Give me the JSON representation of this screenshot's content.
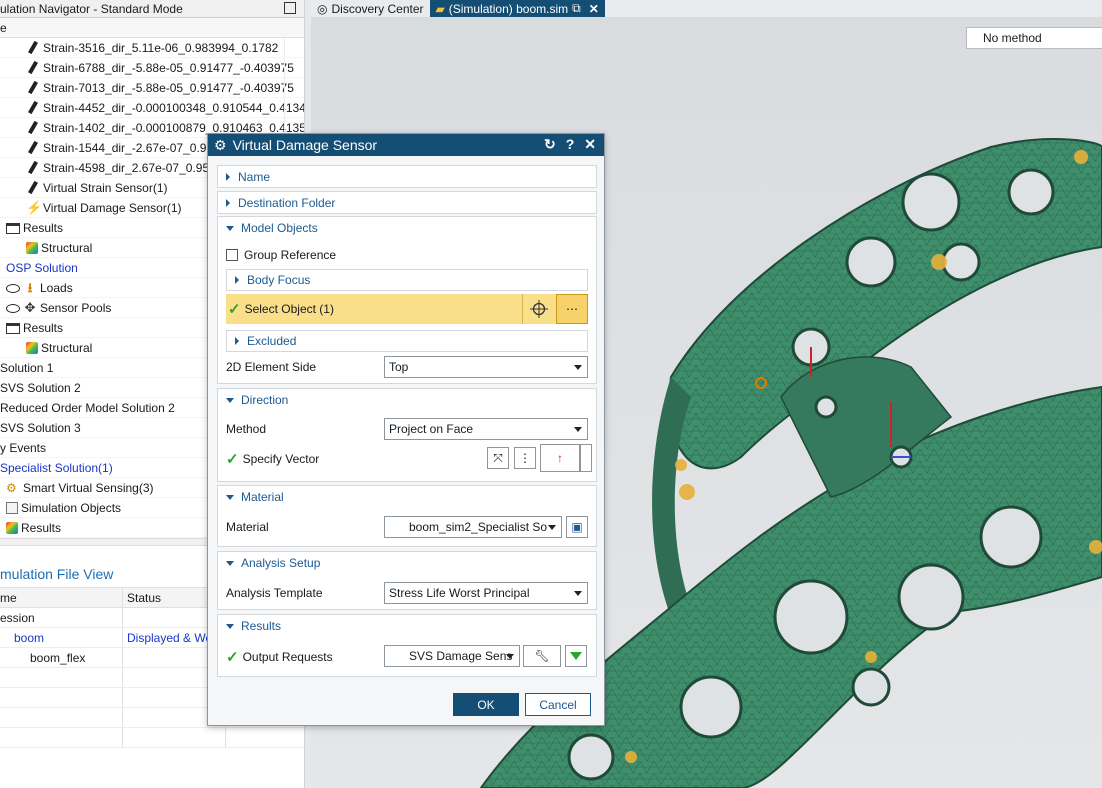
{
  "navigator": {
    "title": "ulation Navigator - Standard Mode",
    "column": "e",
    "rows": [
      {
        "indent": 26,
        "icon": "strain-icon",
        "label": "Strain-3516_dir_5.11e-06_0.983994_0.1782"
      },
      {
        "indent": 26,
        "icon": "strain-icon",
        "label": "Strain-6788_dir_-5.88e-05_0.91477_-0.403975"
      },
      {
        "indent": 26,
        "icon": "strain-icon",
        "label": "Strain-7013_dir_-5.88e-05_0.91477_-0.403975"
      },
      {
        "indent": 26,
        "icon": "strain-icon",
        "label": "Strain-4452_dir_-0.000100348_0.910544_0.4134"
      },
      {
        "indent": 26,
        "icon": "strain-icon",
        "label": "Strain-1402_dir_-0.000100879_0.910463_0.4135"
      },
      {
        "indent": 26,
        "icon": "strain-icon",
        "label": "Strain-1544_dir_-2.67e-07_0.953"
      },
      {
        "indent": 26,
        "icon": "strain-icon",
        "label": "Strain-4598_dir_2.67e-07_0.9530"
      },
      {
        "indent": 26,
        "icon": "strain-icon",
        "label": "Virtual Strain Sensor(1)"
      },
      {
        "indent": 26,
        "icon": "damage-sensor-icon",
        "label": "Virtual Damage Sensor(1)"
      },
      {
        "indent": 6,
        "icon": "folder-icon",
        "label": "Results"
      },
      {
        "indent": 26,
        "icon": "structural-results-icon",
        "label": "Structural"
      },
      {
        "indent": 6,
        "icon": "",
        "label": "OSP Solution",
        "blue": true
      },
      {
        "indent": 6,
        "icon": "eye-load-icon",
        "label": "Loads"
      },
      {
        "indent": 6,
        "icon": "eye-pool-icon",
        "label": "Sensor Pools"
      },
      {
        "indent": 6,
        "icon": "folder-icon",
        "label": "Results"
      },
      {
        "indent": 26,
        "icon": "structural-results-icon",
        "label": "Structural"
      },
      {
        "indent": 0,
        "icon": "",
        "label": " Solution 1"
      },
      {
        "indent": 0,
        "icon": "",
        "label": " SVS Solution 2"
      },
      {
        "indent": 0,
        "icon": "",
        "label": " Reduced Order Model Solution 2"
      },
      {
        "indent": 0,
        "icon": "",
        "label": " SVS Solution 3"
      },
      {
        "indent": 0,
        "icon": "",
        "label": "y Events"
      },
      {
        "indent": 0,
        "icon": "",
        "label": " Specialist Solution(1)",
        "blue": true
      },
      {
        "indent": 6,
        "icon": "svs-icon",
        "label": "Smart Virtual Sensing(3)"
      },
      {
        "indent": 6,
        "icon": "box-icon",
        "label": "Simulation Objects"
      },
      {
        "indent": 6,
        "icon": "structural-results-icon",
        "label": "Results"
      }
    ]
  },
  "file_view": {
    "title": "mulation File View",
    "col_name": "me",
    "col_status": "Status",
    "rows": [
      {
        "indent": 0,
        "label": "ession",
        "status": ""
      },
      {
        "indent": 14,
        "label": "boom",
        "status": "Displayed & Wo",
        "blue": true
      },
      {
        "indent": 30,
        "label": "boom_flex",
        "status": ""
      }
    ]
  },
  "tabs": [
    {
      "label": "Discovery Center",
      "active": false,
      "icon": "discovery-icon"
    },
    {
      "label": "(Simulation) boom.sim",
      "active": true,
      "icon": "simulation-icon"
    }
  ],
  "viewport": {
    "method_value": "No method"
  },
  "dialog": {
    "title": "Virtual Damage Sensor",
    "sections": {
      "name": "Name",
      "destination": "Destination Folder",
      "model_objects": "Model Objects",
      "direction": "Direction",
      "material": "Material",
      "analysis": "Analysis Setup",
      "results": "Results"
    },
    "group_reference": "Group Reference",
    "body_focus": "Body Focus",
    "select_object": "Select Object (1)",
    "excluded": "Excluded",
    "element_side_label": "2D Element Side",
    "element_side_value": "Top",
    "method_label": "Method",
    "method_value": "Project on Face",
    "specify_vector": "Specify Vector",
    "material_label": "Material",
    "material_value": "boom_sim2_Specialist So",
    "template_label": "Analysis Template",
    "template_value": "Stress Life Worst Principal",
    "output_label": "Output Requests",
    "output_value": "SVS Damage Sens",
    "ok": "OK",
    "cancel": "Cancel"
  },
  "colors": {
    "accent": "#154e74",
    "link": "#1c5a92",
    "highlight": "#fadf8a",
    "mesh": "#3e8b6b",
    "check": "#2aa52a"
  }
}
